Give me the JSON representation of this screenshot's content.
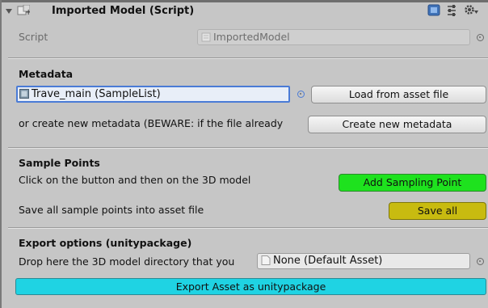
{
  "header": {
    "title": "Imported Model (Script)"
  },
  "script_row": {
    "label": "Script",
    "value": "ImportedModel"
  },
  "metadata": {
    "heading": "Metadata",
    "object_value": "Trave_main (SampleList)",
    "load_label": "Load from asset file",
    "create_text": "or create new metadata (BEWARE: if the file already",
    "create_label": "Create new metadata"
  },
  "sample_points": {
    "heading": "Sample Points",
    "instruction": "Click on the button and then on the 3D model",
    "add_label": "Add Sampling Point",
    "save_text": "Save all sample points into asset file",
    "save_label": "Save all"
  },
  "export": {
    "heading": "Export options (unitypackage)",
    "drop_text": "Drop here the 3D model directory that you",
    "field_value": "None (Default Asset)",
    "export_label": "Export Asset as unitypackage"
  },
  "colors": {
    "panel_bg": "#c6c6c6",
    "selection_border": "#4a7bd6",
    "add_button": "#1ee21e",
    "save_button": "#c8bb10",
    "export_button": "#1fd3e3"
  }
}
